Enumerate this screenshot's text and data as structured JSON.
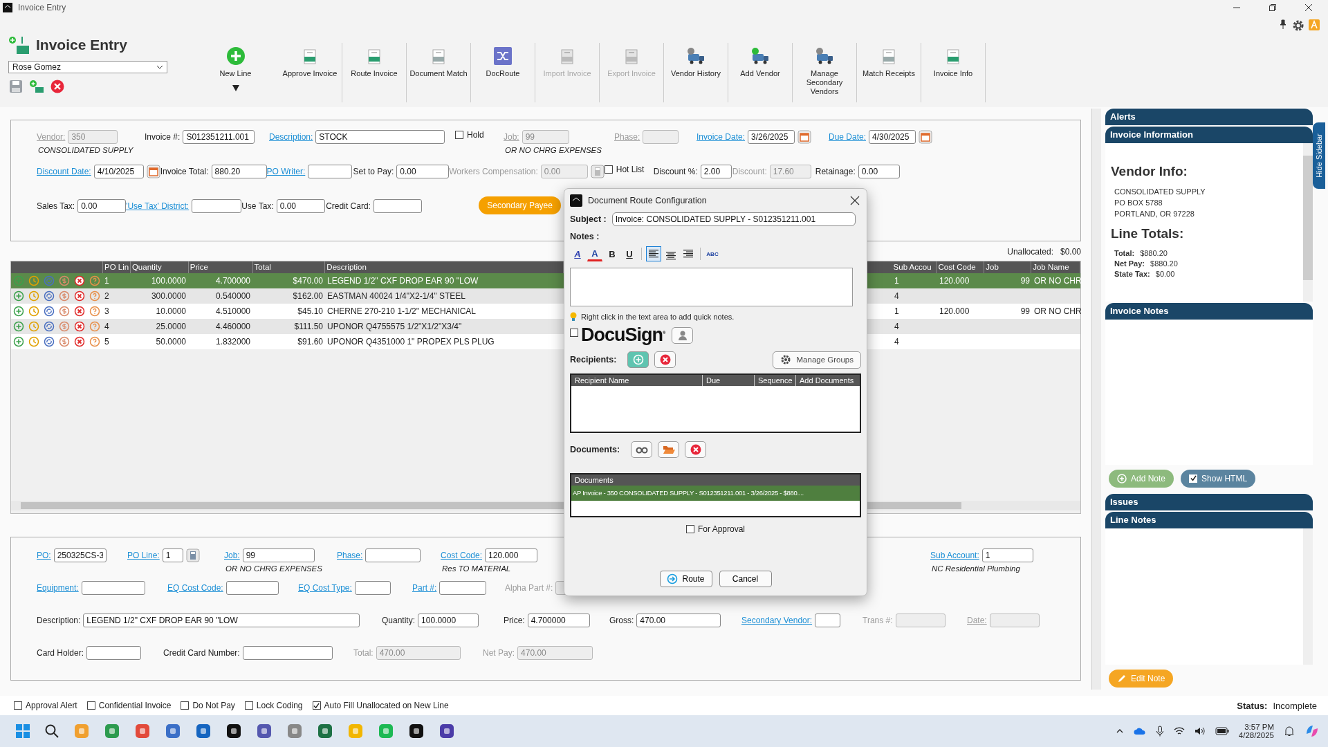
{
  "window": {
    "title": "Invoice Entry"
  },
  "toolbar": {
    "title": "Invoice Entry",
    "user": "Rose Gomez",
    "buttons": [
      {
        "kind": "add",
        "label": "New Line",
        "disabled": false,
        "dropdown": true
      },
      {
        "kind": "approve",
        "label": "Approve Invoice",
        "disabled": false,
        "dropdown": false
      },
      {
        "kind": "route",
        "label": "Route Invoice",
        "disabled": false,
        "dropdown": false
      },
      {
        "kind": "match",
        "label": "Document Match",
        "disabled": false,
        "dropdown": false
      },
      {
        "kind": "docroute",
        "label": "DocRoute",
        "disabled": false,
        "dropdown": false
      },
      {
        "kind": "import",
        "label": "Import Invoice",
        "disabled": true,
        "dropdown": false
      },
      {
        "kind": "export",
        "label": "Export Invoice",
        "disabled": true,
        "dropdown": false
      },
      {
        "kind": "history",
        "label": "Vendor History",
        "disabled": false,
        "dropdown": false
      },
      {
        "kind": "vendor",
        "label": "Add Vendor",
        "disabled": false,
        "dropdown": false
      },
      {
        "kind": "secondary",
        "label": "Manage Secondary Vendors",
        "disabled": false,
        "dropdown": false
      },
      {
        "kind": "receipts",
        "label": "Match Receipts",
        "disabled": false,
        "dropdown": false
      },
      {
        "kind": "info",
        "label": "Invoice Info",
        "disabled": false,
        "dropdown": false
      }
    ]
  },
  "header": {
    "fields": [
      {
        "kind": "text",
        "label": "Vendor:",
        "link": true,
        "value": "350",
        "disabled": true,
        "sub": "CONSOLIDATED SUPPLY"
      },
      {
        "kind": "text",
        "label": "Invoice #:",
        "link": false,
        "value": "S012351211.001",
        "disabled": false
      },
      {
        "kind": "text",
        "label": "Description:",
        "link": true,
        "value": "STOCK",
        "disabled": false
      },
      {
        "kind": "checkbox",
        "label": "Hold",
        "checked": false,
        "disabled": false
      },
      {
        "kind": "text",
        "label": "Job:",
        "link": true,
        "value": "99",
        "disabled": true,
        "sub": "OR NO CHRG  EXPENSES"
      },
      {
        "kind": "text",
        "label": "Phase:",
        "link": true,
        "disabled": true
      },
      {
        "kind": "date",
        "label": "Invoice Date:",
        "link": true,
        "value": "3/26/2025",
        "disabled": false
      },
      {
        "kind": "date",
        "label": "Due Date:",
        "link": true,
        "value": "4/30/2025",
        "disabled": false
      },
      {
        "kind": "date",
        "label": "Discount Date:",
        "link": true,
        "value": "4/10/2025",
        "disabled": false
      },
      {
        "kind": "text",
        "label": "Invoice Total:",
        "link": false,
        "value": "880.20",
        "disabled": false
      },
      {
        "kind": "text",
        "label": "PO Writer:",
        "link": true,
        "disabled": false
      },
      {
        "kind": "text",
        "label": "Set to Pay:",
        "link": false,
        "value": "0.00",
        "disabled": false
      },
      {
        "kind": "calc",
        "label": "Workers Compensation:",
        "link": false,
        "value": "0.00",
        "disabled": true
      },
      {
        "kind": "checkbox",
        "label": "Hot List",
        "checked": false,
        "disabled": false
      },
      {
        "kind": "text",
        "label": "Discount %:",
        "link": false,
        "value": "2.00",
        "disabled": false
      },
      {
        "kind": "text",
        "label": "Discount:",
        "link": false,
        "value": "17.60",
        "disabled": true
      },
      {
        "kind": "text",
        "label": "Retainage:",
        "link": false,
        "value": "0.00",
        "disabled": false
      },
      {
        "kind": "text",
        "label": "Sales Tax:",
        "link": false,
        "value": "0.00",
        "disabled": false
      },
      {
        "kind": "text",
        "label": "'Use Tax' District:",
        "link": true,
        "disabled": false
      },
      {
        "kind": "text",
        "label": "Use Tax:",
        "link": false,
        "value": "0.00",
        "disabled": false
      },
      {
        "kind": "text",
        "label": "Credit Card:",
        "link": false,
        "disabled": false
      },
      {
        "kind": "button",
        "label": "Secondary Payee",
        "disabled": false
      }
    ]
  },
  "unallocated": {
    "label": "Unallocated:",
    "value": "$0.00"
  },
  "table": {
    "columns": [
      "PO Lin",
      "Quantity",
      "Price",
      "Total",
      "Description",
      "Sub Accou",
      "Cost Code",
      "Job",
      "Job Name"
    ],
    "rows": [
      {
        "selected": true,
        "po_line": "1",
        "quantity": "100.0000",
        "price": "4.700000",
        "total": "$470.00",
        "description": "LEGEND 1/2\" CXF DROP EAR 90 \"LOW",
        "sub_account": "1",
        "cost_code": "120.000",
        "job": "99",
        "job_name": "OR NO CHR"
      },
      {
        "selected": false,
        "po_line": "2",
        "quantity": "300.0000",
        "price": "0.540000",
        "total": "$162.00",
        "description": "EASTMAN 40024 1/4\"X2-1/4\" STEEL",
        "sub_account": "4"
      },
      {
        "selected": false,
        "po_line": "3",
        "quantity": "10.0000",
        "price": "4.510000",
        "total": "$45.10",
        "description": "CHERNE 270-210 1-1/2\" MECHANICAL",
        "sub_account": "1",
        "cost_code": "120.000",
        "job": "99",
        "job_name": "OR NO CHR"
      },
      {
        "selected": false,
        "po_line": "4",
        "quantity": "25.0000",
        "price": "4.460000",
        "total": "$111.50",
        "description": "UPONOR Q4755575 1/2\"X1/2\"X3/4\"",
        "sub_account": "4"
      },
      {
        "selected": false,
        "po_line": "5",
        "quantity": "50.0000",
        "price": "1.832000",
        "total": "$91.60",
        "description": "UPONOR Q4351000 1\" PROPEX PLS PLUG",
        "sub_account": "4"
      }
    ]
  },
  "line": {
    "fields": [
      {
        "kind": "text",
        "label": "PO:",
        "link": true,
        "value": "250325CS-3",
        "disabled": false
      },
      {
        "kind": "calc",
        "label": "PO Line:",
        "link": true,
        "value": "1",
        "disabled": false
      },
      {
        "kind": "text",
        "label": "Job:",
        "link": true,
        "value": "99",
        "disabled": false,
        "sub": "OR NO CHRG  EXPENSES"
      },
      {
        "kind": "text",
        "label": "Phase:",
        "link": true,
        "disabled": false
      },
      {
        "kind": "text",
        "label": "Cost Code:",
        "link": true,
        "value": "120.000",
        "disabled": false,
        "sub": "Res TO MATERIAL"
      },
      {
        "kind": "text",
        "label": "Sub Account:",
        "link": true,
        "value": "1",
        "disabled": false,
        "sub": "NC Residential Plumbing"
      },
      {
        "kind": "text",
        "label": "Equipment:",
        "link": true,
        "disabled": false
      },
      {
        "kind": "text",
        "label": "EQ Cost Code:",
        "link": true,
        "disabled": false
      },
      {
        "kind": "text",
        "label": "EQ Cost Type:",
        "link": true,
        "disabled": false
      },
      {
        "kind": "text",
        "label": "Part #:",
        "link": true,
        "disabled": false
      },
      {
        "kind": "text",
        "label": "Alpha Part #:",
        "link": false,
        "disabled": true
      },
      {
        "kind": "text",
        "label": "Description:",
        "link": false,
        "value": "LEGEND 1/2\" CXF DROP EAR 90 \"LOW",
        "disabled": false
      },
      {
        "kind": "text",
        "label": "Quantity:",
        "link": false,
        "value": "100.0000",
        "disabled": false
      },
      {
        "kind": "text",
        "label": "Price:",
        "link": false,
        "value": "4.700000",
        "disabled": false
      },
      {
        "kind": "text",
        "label": "Gross:",
        "link": false,
        "value": "470.00",
        "disabled": false
      },
      {
        "kind": "text",
        "label": "Secondary Vendor:",
        "link": true,
        "disabled": false
      },
      {
        "kind": "text",
        "label": "Trans #:",
        "link": false,
        "disabled": true
      },
      {
        "kind": "text",
        "label": "Date:",
        "link": true,
        "disabled": true
      },
      {
        "kind": "text",
        "label": "Card Holder:",
        "link": false,
        "disabled": false
      },
      {
        "kind": "text",
        "label": "Credit Card Number:",
        "link": false,
        "disabled": false
      },
      {
        "kind": "text",
        "label": "Total:",
        "link": false,
        "value": "470.00",
        "disabled": true
      },
      {
        "kind": "text",
        "label": "Net Pay:",
        "link": false,
        "value": "470.00",
        "disabled": true
      }
    ]
  },
  "footer": {
    "options": [
      {
        "label": "Approval Alert",
        "checked": false
      },
      {
        "label": "Confidential Invoice",
        "checked": false
      },
      {
        "label": "Do Not Pay",
        "checked": false
      },
      {
        "label": "Lock Coding",
        "checked": false
      },
      {
        "label": "Auto Fill Unallocated on New Line",
        "checked": true
      }
    ],
    "status_label": "Status:",
    "status": "Incomplete"
  },
  "sidebar": {
    "tab": "Hide Sidebar",
    "alerts": "Alerts",
    "info_title": "Invoice Information",
    "vendor_heading": "Vendor Info:",
    "vendor_lines": [
      "CONSOLIDATED SUPPLY",
      "PO BOX 5788",
      "PORTLAND, OR 97228"
    ],
    "totals_heading": "Line Totals:",
    "totals": [
      {
        "label": "Total:",
        "value": "$880.20"
      },
      {
        "label": "Net Pay:",
        "value": "$880.20"
      },
      {
        "label": "State Tax:",
        "value": "$0.00"
      }
    ],
    "notes_title": "Invoice Notes",
    "add_note": "Add Note",
    "show_html": {
      "label": "Show HTML",
      "checked": true
    },
    "issues": "Issues",
    "line_notes": "Line Notes",
    "edit_note": "Edit Note"
  },
  "dialog": {
    "title": "Document Route Configuration",
    "subject_label": "Subject :",
    "subject": "Invoice: CONSOLIDATED SUPPLY - S012351211.001",
    "notes_label": "Notes :",
    "format_tools": [
      {
        "kind": "font",
        "label": "A",
        "selected": false
      },
      {
        "kind": "color",
        "label": "A",
        "selected": false
      },
      {
        "kind": "bold",
        "label": "B",
        "selected": false
      },
      {
        "kind": "underline",
        "label": "U",
        "selected": false
      },
      {
        "kind": "left",
        "selected": true
      },
      {
        "kind": "center",
        "selected": false
      },
      {
        "kind": "right",
        "selected": false
      },
      {
        "kind": "spell",
        "label": "ABC",
        "selected": false
      }
    ],
    "hint": "Right click in the text area to add quick notes.",
    "docusign": {
      "checked": false,
      "logo": "DocuSign$^{®}$"
    },
    "recipients_label": "Recipients:",
    "manage_groups": "Manage Groups",
    "recipient_columns": [
      "Recipient Name",
      "Due",
      "Sequence",
      "Add Documents"
    ],
    "documents_label": "Documents:",
    "documents_column": "Documents",
    "documents": [
      {
        "label": "AP Invoice - 350 CONSOLIDATED SUPPLY - S012351211.001 - 3/26/2025 - $880....",
        "selected": true
      }
    ],
    "for_approval": {
      "label": "For Approval",
      "checked": false
    },
    "route": "Route",
    "cancel": "Cancel"
  },
  "taskbar": {
    "time": "3:57 PM",
    "date": "4/28/2025"
  }
}
